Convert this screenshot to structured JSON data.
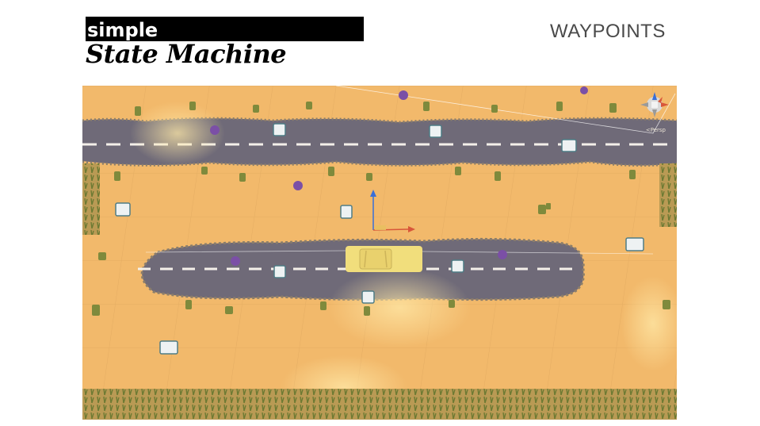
{
  "header": {
    "title_small": "simple",
    "title_script": "State Machine",
    "section": "WAYPOINTS"
  },
  "scene": {
    "persp_label": "<Persp",
    "gizmo": "scene-orientation-gizmo",
    "colors": {
      "ground": "#f2b96b",
      "road": "#6f6a78",
      "lane": "#f4f0ea",
      "car": "#f1de7c",
      "grass": "#6b7a3a"
    }
  }
}
